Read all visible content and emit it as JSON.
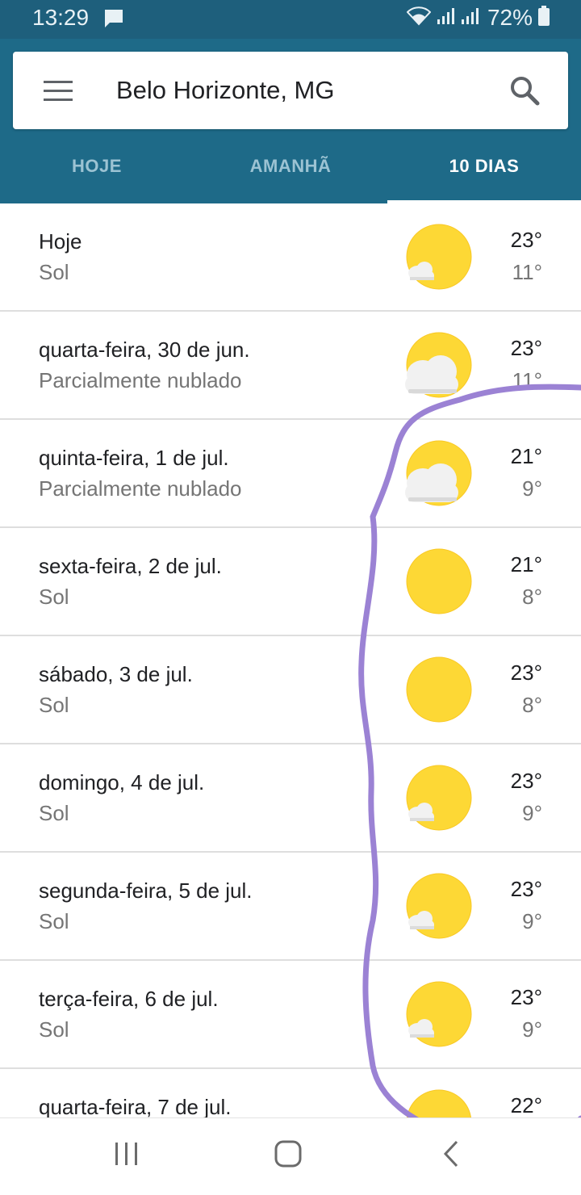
{
  "status_bar": {
    "time": "13:29",
    "battery": "72%"
  },
  "search": {
    "location": "Belo Horizonte, MG"
  },
  "tabs": [
    {
      "label": "HOJE"
    },
    {
      "label": "AMANHÃ"
    },
    {
      "label": "10 DIAS",
      "selected": true
    }
  ],
  "forecast": [
    {
      "day": "Hoje",
      "condition": "Sol",
      "high": "23°",
      "low": "11°",
      "icon": "sun-small-cloud-icon"
    },
    {
      "day": "quarta-feira, 30 de jun.",
      "condition": "Parcialmente nublado",
      "high": "23°",
      "low": "11°",
      "icon": "partly-cloudy-icon"
    },
    {
      "day": "quinta-feira, 1 de jul.",
      "condition": "Parcialmente nublado",
      "high": "21°",
      "low": "9°",
      "icon": "partly-cloudy-icon"
    },
    {
      "day": "sexta-feira, 2 de jul.",
      "condition": "Sol",
      "high": "21°",
      "low": "8°",
      "icon": "sun-icon"
    },
    {
      "day": "sábado, 3 de jul.",
      "condition": "Sol",
      "high": "23°",
      "low": "8°",
      "icon": "sun-icon"
    },
    {
      "day": "domingo, 4 de jul.",
      "condition": "Sol",
      "high": "23°",
      "low": "9°",
      "icon": "sun-small-cloud-icon"
    },
    {
      "day": "segunda-feira, 5 de jul.",
      "condition": "Sol",
      "high": "23°",
      "low": "9°",
      "icon": "sun-small-cloud-icon"
    },
    {
      "day": "terça-feira, 6 de jul.",
      "condition": "Sol",
      "high": "23°",
      "low": "9°",
      "icon": "sun-small-cloud-icon"
    },
    {
      "day": "quarta-feira, 7 de jul.",
      "condition": "",
      "high": "22°",
      "low": "",
      "icon": "sun-icon"
    }
  ],
  "colors": {
    "status_bar": "#1e5f7c",
    "app_bar": "#1e6a88",
    "sun": "#fdd835",
    "annotation": "#9b82d4"
  }
}
